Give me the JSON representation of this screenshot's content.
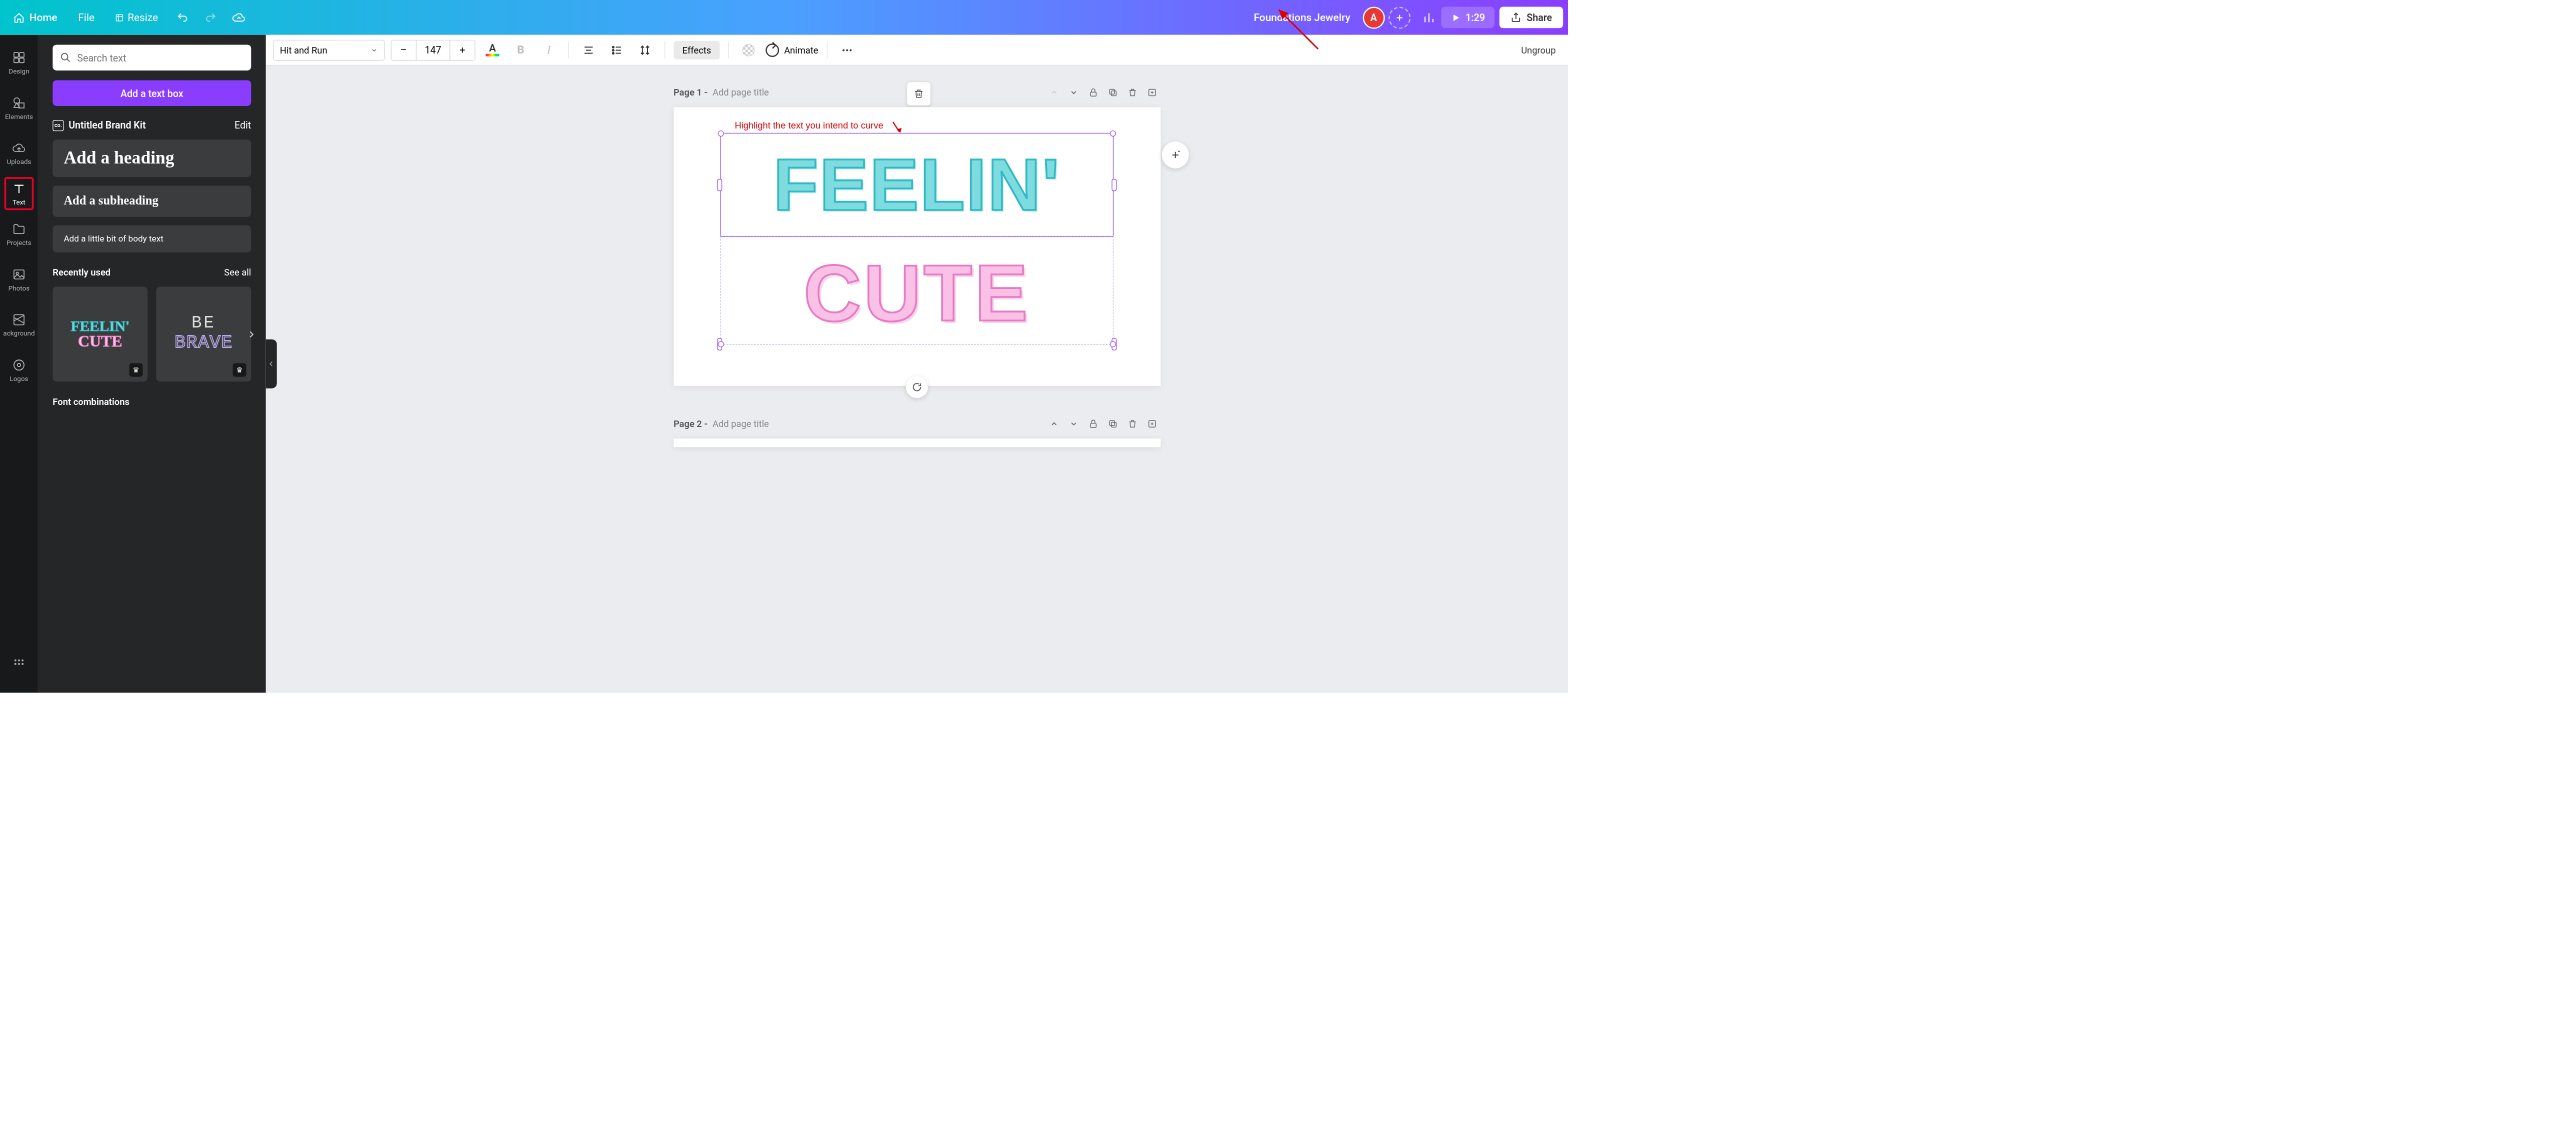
{
  "topbar": {
    "home": "Home",
    "file": "File",
    "resize": "Resize",
    "project_title": "Foundations Jewelry",
    "avatar_initial": "A",
    "play_time": "1:29",
    "share": "Share"
  },
  "rail": {
    "items": [
      "Design",
      "Elements",
      "Uploads",
      "Text",
      "Projects",
      "Photos",
      "ackground",
      "Logos"
    ]
  },
  "sidepanel": {
    "search_placeholder": "Search text",
    "add_text_box": "Add a text box",
    "brand_kit": "Untitled Brand Kit",
    "edit": "Edit",
    "add_heading": "Add a heading",
    "add_subheading": "Add a subheading",
    "add_body": "Add a little bit of body text",
    "recently_used": "Recently used",
    "see_all": "See all",
    "thumb1_line1": "FEELIN'",
    "thumb1_line2": "CUTE",
    "thumb2_line1": "BE",
    "thumb2_line2": "BRAVE",
    "font_combinations": "Font combinations"
  },
  "ctxbar": {
    "font": "Hit and Run",
    "size": "147",
    "minus": "–",
    "plus": "+",
    "effects": "Effects",
    "animate": "Animate",
    "ungroup": "Ungroup"
  },
  "pages": {
    "page1_label": "Page 1 -",
    "page_title_placeholder": "Add page title",
    "page2_label": "Page 2 -",
    "hint": "Highlight the text you intend to curve",
    "text_feelin": "FEELIN'",
    "text_cute": "CUTE"
  }
}
